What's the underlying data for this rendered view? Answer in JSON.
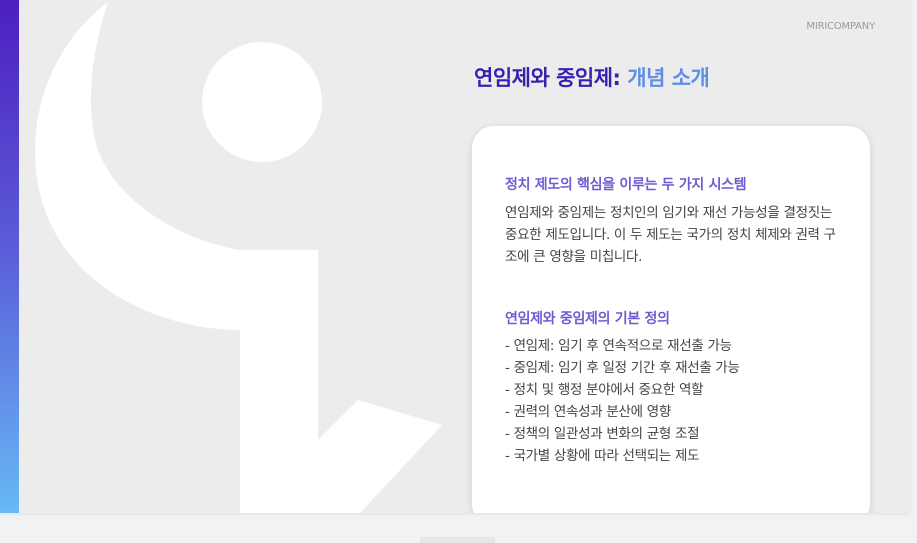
{
  "header": {
    "company": "MIRICOMPANY",
    "title_part1": "연임제와 중임제:",
    "title_part2": "개념 소개"
  },
  "card": {
    "section1": {
      "heading": "정치 제도의 핵심을 이루는 두 가지 시스템",
      "body": "연임제와 중임제는 정치인의 임기와 재선 가능성을 결정짓는 중요한 제도입니다. 이 두 제도는 국가의 정치 체제와 권력 구조에 큰 영향을 미칩니다."
    },
    "section2": {
      "heading": "연임제와 중임제의 기본 정의",
      "items": [
        "- 연임제: 임기 후 연속적으로 재선출 가능",
        "- 중임제: 임기 후 일정 기간 후 재선출 가능",
        "- 정치 및 행정 분야에서 중요한 역할",
        "- 권력의 연속성과 분산에 영향",
        "- 정책의 일관성과 변화의 균형 조절",
        "- 국가별 상황에 따라 선택되는 제도"
      ]
    }
  },
  "colors": {
    "title_dark": "#3a1fae",
    "title_light": "#5f8ee6",
    "section_heading": "#6f5bd3",
    "accent_top": "#4d1fc0",
    "accent_bottom": "#66b9f6"
  }
}
